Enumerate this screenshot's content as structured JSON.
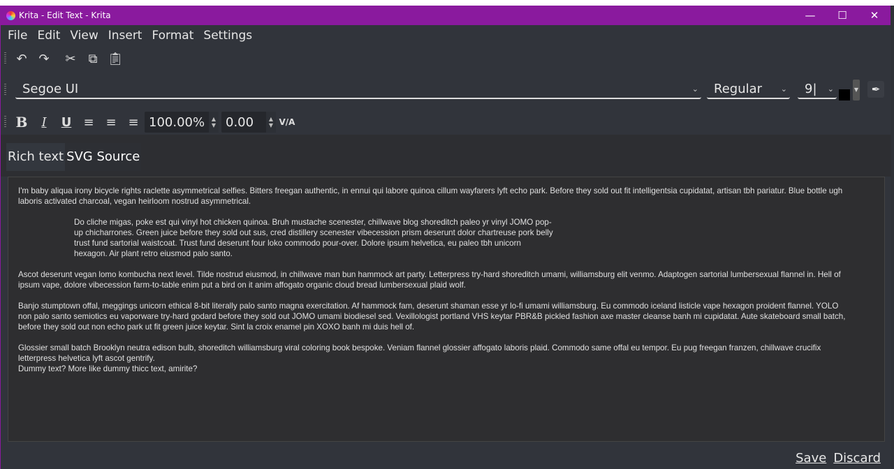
{
  "title": "Krita - Edit Text - Krita",
  "menu": [
    "File",
    "Edit",
    "View",
    "Insert",
    "Format",
    "Settings"
  ],
  "font": {
    "family": "Segoe UI",
    "style": "Regular",
    "size": "9",
    "color": "#000000"
  },
  "spin": {
    "scale": "100.00%",
    "spacing": "0.00"
  },
  "tabs": [
    "Rich text",
    "SVG Source"
  ],
  "paragraphs": [
    {
      "indent": false,
      "lines": [
        "I'm baby aliqua irony bicycle rights raclette asymmetrical selfies. Bitters freegan authentic, in ennui qui labore quinoa cillum wayfarers lyft echo park. Before they sold out fit intelligentsia cupidatat, artisan tbh pariatur. Blue bottle ugh",
        "laboris activated charcoal, vegan heirloom nostrud asymmetrical."
      ]
    },
    {
      "indent": true,
      "lines": [
        "Do cliche migas, poke est qui vinyl hot chicken quinoa. Bruh mustache scenester, chillwave blog shoreditch paleo yr vinyl JOMO pop-",
        "up chicharrones. Green juice before they sold out sus, cred distillery scenester vibecession prism deserunt dolor chartreuse pork belly",
        "trust fund sartorial waistcoat. Trust fund deserunt four loko commodo pour-over. Dolore ipsum helvetica, eu paleo tbh unicorn",
        "hexagon. Air plant retro eiusmod palo santo."
      ]
    },
    {
      "indent": false,
      "lines": [
        "Ascot deserunt vegan lomo kombucha next level. Tilde nostrud eiusmod, in chillwave man bun hammock art party. Letterpress try-hard shoreditch umami, williamsburg elit venmo. Adaptogen sartorial lumbersexual flannel in. Hell of",
        "ipsum vape, dolore vibecession farm-to-table enim put a bird on it anim affogato organic cloud bread lumbersexual plaid wolf."
      ]
    },
    {
      "indent": false,
      "lines": [
        "Banjo stumptown offal, meggings unicorn ethical 8-bit literally palo santo magna exercitation. Af hammock fam, deserunt shaman esse yr lo-fi umami williamsburg. Eu commodo iceland listicle vape hexagon proident flannel. YOLO",
        "non palo santo semiotics eu vaporware try-hard godard before they sold out JOMO umami biodiesel sed. Vexillologist portland VHS keytar PBR&B pickled fashion axe master cleanse banh mi cupidatat. Aute skateboard small batch,",
        "before they sold out non echo park ut fit green juice keytar. Sint la croix enamel pin XOXO banh mi duis hell of."
      ]
    },
    {
      "indent": false,
      "lines": [
        "Glossier small batch Brooklyn neutra edison bulb, shoreditch williamsburg viral coloring book bespoke. Veniam flannel glossier affogato laboris plaid. Commodo same offal eu tempor. Eu pug freegan franzen, chillwave crucifix",
        "letterpress helvetica lyft ascot gentrify.",
        "Dummy text? More like dummy thicc text, amirite?"
      ]
    }
  ],
  "buttons": {
    "save": "Save",
    "discard": "Discard"
  }
}
